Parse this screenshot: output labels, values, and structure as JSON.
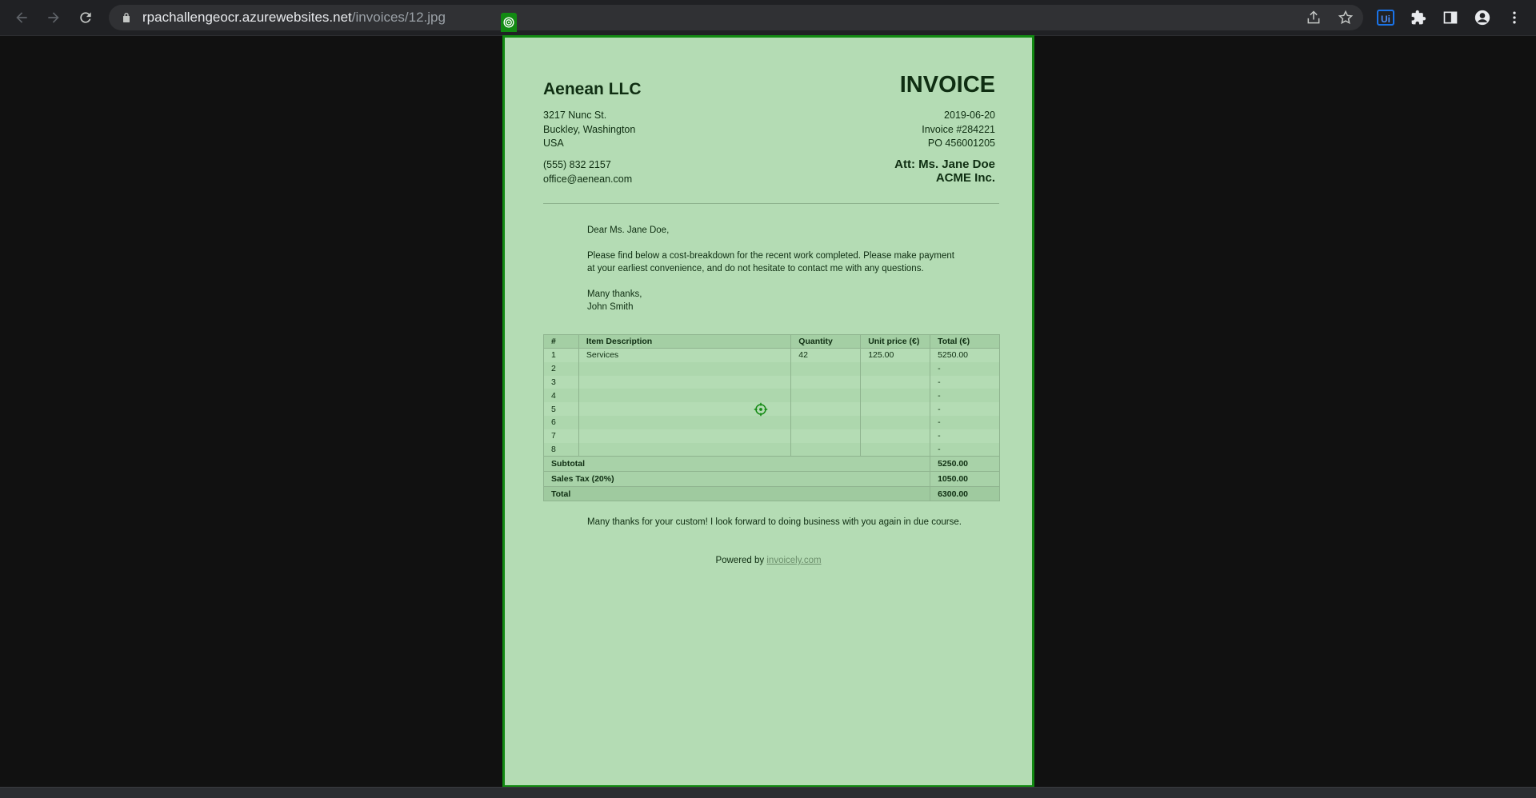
{
  "browser": {
    "url_host": "rpachallengeocr.azurewebsites.net",
    "url_path": "/invoices/12.jpg",
    "icons": [
      "back-icon",
      "forward-icon",
      "reload-icon",
      "lock-icon",
      "share-icon",
      "star-icon",
      "uipath-extension-icon",
      "extensions-puzzle-icon",
      "side-panel-icon",
      "profile-icon",
      "menu-kebab-icon"
    ],
    "extension_label": "Ui"
  },
  "invoice": {
    "company": "Aenean LLC",
    "title": "INVOICE",
    "address": [
      "3217 Nunc St.",
      "Buckley, Washington",
      "USA"
    ],
    "contact": [
      "(555) 832 2157",
      "office@aenean.com"
    ],
    "meta": [
      "2019-06-20",
      "Invoice #284221",
      "PO 456001205"
    ],
    "attention": [
      "Att: Ms. Jane Doe",
      "ACME Inc."
    ],
    "letter": {
      "greeting": "Dear Ms. Jane Doe,",
      "body": "Please find below a cost-breakdown for the recent work completed. Please make payment at your earliest convenience, and do not hesitate to contact me with any questions.",
      "signoff": "Many thanks,",
      "signature": "John Smith"
    },
    "table": {
      "headers": [
        "#",
        "Item Description",
        "Quantity",
        "Unit price (€)",
        "Total (€)"
      ],
      "rows": [
        [
          "1",
          "Services",
          "42",
          "125.00",
          "5250.00"
        ],
        [
          "2",
          "",
          "",
          "",
          "-"
        ],
        [
          "3",
          "",
          "",
          "",
          "-"
        ],
        [
          "4",
          "",
          "",
          "",
          "-"
        ],
        [
          "5",
          "",
          "",
          "",
          "-"
        ],
        [
          "6",
          "",
          "",
          "",
          "-"
        ],
        [
          "7",
          "",
          "",
          "",
          "-"
        ],
        [
          "8",
          "",
          "",
          "",
          "-"
        ]
      ],
      "subtotal_label": "Subtotal",
      "subtotal": "5250.00",
      "tax_label": "Sales Tax (20%)",
      "tax": "1050.00",
      "total_label": "Total",
      "total": "6300.00"
    },
    "closing": "Many thanks for your custom! I look forward to doing business with you again in due course.",
    "powered_prefix": "Powered by",
    "powered_link": "invoicely.com"
  },
  "colors": {
    "highlight_border": "#128a12",
    "highlight_fill": "#b4dcb4",
    "chrome_bg": "#202124"
  }
}
